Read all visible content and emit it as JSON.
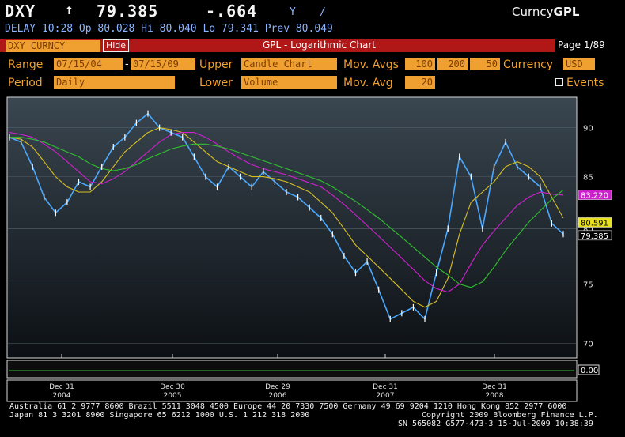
{
  "quote": {
    "ticker": "DXY",
    "arrow": "↑",
    "price": "79.385",
    "change": "-.664",
    "change_glyph": "Y",
    "slash": "/",
    "source_prefix": "Curncy",
    "source_suffix": "GPL",
    "line2": "DELAY 10:28 Op 80.028   Hi 80.040   Lo 79.341   Prev 80.049"
  },
  "titlebar": {
    "security": "DXY CURNCY",
    "hide_label": "Hide",
    "title": "GPL - Logarithmic Chart",
    "page": "Page 1/89"
  },
  "controls": {
    "range_label": "Range",
    "range_start": "07/15/04",
    "range_sep": "-",
    "range_end": "07/15/09",
    "upper_label": "Upper",
    "upper_value": "Candle Chart",
    "mov_avgs_label": "Mov. Avgs",
    "mov_avgs": [
      "100",
      "200",
      "50"
    ],
    "currency_label": "Currency",
    "currency_value": "USD",
    "period_label": "Period",
    "period_value": "Daily",
    "lower_label": "Lower",
    "lower_value": "Volume",
    "mov_avg_label": "Mov. Avg",
    "mov_avg_value": "20",
    "events_label": "Events"
  },
  "chart_data": {
    "type": "line",
    "scale": "log",
    "ylim": [
      69,
      93
    ],
    "y_ticks": [
      "90",
      "85",
      "80",
      "75",
      "70"
    ],
    "x_ticks": [
      {
        "top": "Dec 31",
        "bottom": "2004"
      },
      {
        "top": "Dec 30",
        "bottom": "2005"
      },
      {
        "top": "Dec 29",
        "bottom": "2006"
      },
      {
        "top": "Dec 31",
        "bottom": "2007"
      },
      {
        "top": "Dec 31",
        "bottom": "2008"
      }
    ],
    "series": [
      {
        "values": [
          89.0,
          88.5,
          86.0,
          83.0,
          81.5,
          82.5,
          84.5,
          84.0,
          86.0,
          88.0,
          89.0,
          90.5,
          91.5,
          90.0,
          89.5,
          89.0,
          87.0,
          85.0,
          84.0,
          86.0,
          85.0,
          84.0,
          85.5,
          84.5,
          83.5,
          83.0,
          82.0,
          81.0,
          79.5,
          77.5,
          76.0,
          77.0,
          74.5,
          72.0,
          72.5,
          73.0,
          72.0,
          76.0,
          80.0,
          87.0,
          85.0,
          80.0,
          86.0,
          88.5,
          86.0,
          85.0,
          84.0,
          80.5,
          79.5
        ]
      },
      {
        "values": [
          89.0,
          88.8,
          88.0,
          86.5,
          85.0,
          84.0,
          83.5,
          83.5,
          84.5,
          86.0,
          87.5,
          88.5,
          89.5,
          90.0,
          89.8,
          89.5,
          88.5,
          87.5,
          86.5,
          86.0,
          85.5,
          85.0,
          85.0,
          84.8,
          84.5,
          84.0,
          83.5,
          82.5,
          81.5,
          80.0,
          78.5,
          77.5,
          76.5,
          75.5,
          74.5,
          73.5,
          73.0,
          73.5,
          75.5,
          79.5,
          82.5,
          83.5,
          84.5,
          86.0,
          86.5,
          86.0,
          85.0,
          83.0,
          81.0
        ]
      },
      {
        "values": [
          89.5,
          89.3,
          89.0,
          88.3,
          87.5,
          86.5,
          85.5,
          84.5,
          84.3,
          84.8,
          85.5,
          86.5,
          87.5,
          88.5,
          89.3,
          89.5,
          89.5,
          89.0,
          88.3,
          87.5,
          86.8,
          86.2,
          85.8,
          85.5,
          85.2,
          84.8,
          84.4,
          84.0,
          83.2,
          82.3,
          81.3,
          80.3,
          79.3,
          78.3,
          77.3,
          76.3,
          75.3,
          74.6,
          74.3,
          75.0,
          76.8,
          78.5,
          79.8,
          81.0,
          82.2,
          83.0,
          83.5,
          83.3,
          83.2
        ]
      },
      {
        "values": [
          89.0,
          89.0,
          88.8,
          88.5,
          88.0,
          87.5,
          87.0,
          86.3,
          85.8,
          85.6,
          85.8,
          86.2,
          86.8,
          87.3,
          87.8,
          88.1,
          88.3,
          88.3,
          88.1,
          87.8,
          87.4,
          87.0,
          86.6,
          86.2,
          85.8,
          85.4,
          85.0,
          84.6,
          84.0,
          83.3,
          82.6,
          81.8,
          81.0,
          80.1,
          79.2,
          78.3,
          77.4,
          76.5,
          75.8,
          75.0,
          74.7,
          75.2,
          76.5,
          78.0,
          79.3,
          80.6,
          81.7,
          82.8,
          83.7
        ]
      }
    ],
    "price_tags": [
      {
        "value": "83.220",
        "bg": "#cc20cc",
        "fg": "#ffffff",
        "y": 83.22
      },
      {
        "value": "80.591",
        "bg": "#e8e020",
        "fg": "#000000",
        "y": 80.591
      },
      {
        "value": "79.385",
        "bg": "#000000",
        "fg": "#ffffff",
        "y": 79.385
      }
    ],
    "volume_tag": "0.00"
  },
  "colors": {
    "price": "#4aa8ff",
    "ma50": "#d8c020",
    "ma100": "#d020d0",
    "ma200": "#30c030"
  },
  "footer": {
    "line1": "Australia 61 2 9777 8600 Brazil 5511 3048 4500 Europe 44 20 7330 7500 Germany 49 69 9204 1210 Hong Kong 852 2977 6000",
    "line2_left": "Japan 81 3 3201 8900        Singapore 65 6212 1000       U.S. 1 212 318 2000",
    "line2_right": "Copyright 2009 Bloomberg Finance L.P.",
    "line3": "SN 565082 G577-473-3 15-Jul-2009 10:38:39"
  }
}
